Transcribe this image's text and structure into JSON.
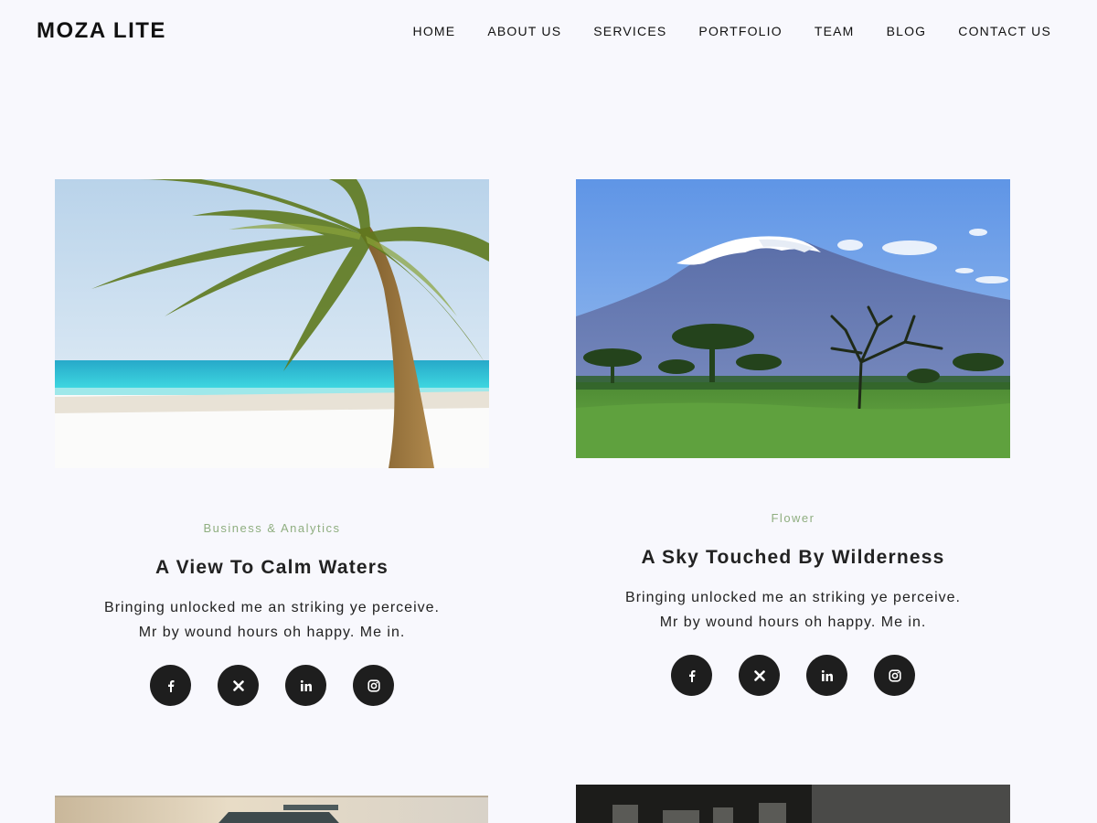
{
  "site": {
    "title": "MOZA LITE"
  },
  "nav": {
    "items": [
      {
        "label": "HOME"
      },
      {
        "label": "ABOUT US"
      },
      {
        "label": "SERVICES"
      },
      {
        "label": "PORTFOLIO"
      },
      {
        "label": "TEAM"
      },
      {
        "label": "BLOG"
      },
      {
        "label": "CONTACT US"
      }
    ]
  },
  "colors": {
    "background": "#f8f8fd",
    "category": "#8fae80",
    "social_button": "#1e1e1e"
  },
  "posts": [
    {
      "image": "palm-beach-photo",
      "category": "Business & Analytics",
      "title": "A View To Calm Waters",
      "excerpt_line1": "Bringing unlocked me an striking ye perceive.",
      "excerpt_line2": "Mr by wound hours oh happy. Me in.",
      "social": [
        "facebook-icon",
        "x-icon",
        "linkedin-icon",
        "instagram-icon"
      ]
    },
    {
      "image": "kilimanjaro-savanna-photo",
      "category": "Flower",
      "title": "A Sky Touched By Wilderness",
      "excerpt_line1": "Bringing unlocked me an striking ye perceive.",
      "excerpt_line2": "Mr by wound hours oh happy. Me in.",
      "social": [
        "facebook-icon",
        "x-icon",
        "linkedin-icon",
        "instagram-icon"
      ]
    },
    {
      "image": "interior-photo"
    },
    {
      "image": "dark-office-photo"
    }
  ]
}
